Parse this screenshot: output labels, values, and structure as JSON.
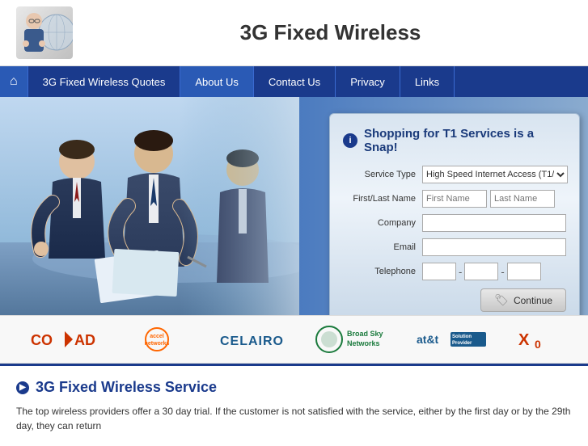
{
  "header": {
    "title": "3G Fixed Wireless"
  },
  "nav": {
    "home_icon": "⌂",
    "items": [
      {
        "label": "3G Fixed Wireless Quotes",
        "active": false
      },
      {
        "label": "About Us",
        "active": false
      },
      {
        "label": "Contact Us",
        "active": false
      },
      {
        "label": "Privacy",
        "active": false
      },
      {
        "label": "Links",
        "active": false
      }
    ]
  },
  "form": {
    "title": "Shopping for T1 Services is a Snap!",
    "info_icon": "i",
    "fields": {
      "service_type_label": "Service Type",
      "service_type_value": "High Speed Internet Access (T1/DS",
      "first_last_label": "First/Last Name",
      "first_name_placeholder": "First Name",
      "last_name_placeholder": "Last Name",
      "company_label": "Company",
      "email_label": "Email",
      "telephone_label": "Telephone"
    },
    "continue_label": "Continue"
  },
  "logos": [
    {
      "name": "COVAD",
      "display": "CO►D"
    },
    {
      "name": "accel networks",
      "display": "accel networks"
    },
    {
      "name": "CELAIRO",
      "display": "CELAIRO"
    },
    {
      "name": "Broad Sky Networks",
      "display": "Broad Sky Networks"
    },
    {
      "name": "AT&T Solution Provider",
      "display": "at&t Solution Provider"
    },
    {
      "name": "XO",
      "display": "X₀"
    }
  ],
  "content": {
    "title": "3G Fixed Wireless Service",
    "icon": "▶",
    "text": "The top wireless providers offer a 30 day trial. If the customer is not satisfied with the service, either by the first day or by the 29th day, they can return"
  }
}
